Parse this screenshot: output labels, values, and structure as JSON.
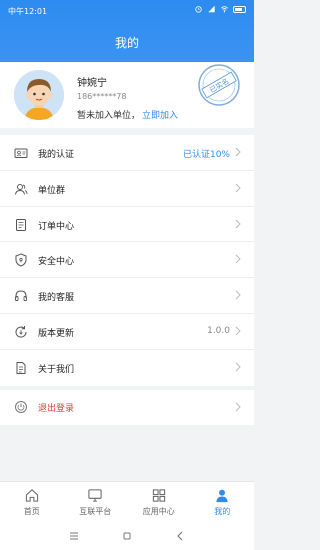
{
  "status": {
    "time": "中午12:01"
  },
  "header": {
    "title": "我的"
  },
  "profile": {
    "name": "钟婉宁",
    "phone": "186******78",
    "unit_text": "暂未加入单位，",
    "join_link": "立即加入",
    "stamp_text": "已实名"
  },
  "menu": [
    {
      "label": "我的认证",
      "value": "已认证10%",
      "icon": "id-card-icon"
    },
    {
      "label": "单位群",
      "value": "",
      "icon": "group-icon"
    },
    {
      "label": "订单中心",
      "value": "",
      "icon": "order-icon"
    },
    {
      "label": "安全中心",
      "value": "",
      "icon": "shield-icon"
    },
    {
      "label": "我的客服",
      "value": "",
      "icon": "headset-icon"
    },
    {
      "label": "版本更新",
      "value": "1.0.0",
      "icon": "update-icon"
    },
    {
      "label": "关于我们",
      "value": "",
      "icon": "document-icon"
    }
  ],
  "logout": {
    "label": "退出登录",
    "icon": "power-icon"
  },
  "tabs": [
    {
      "label": "首页",
      "icon": "home-icon",
      "active": false
    },
    {
      "label": "互联平台",
      "icon": "monitor-icon",
      "active": false
    },
    {
      "label": "应用中心",
      "icon": "grid-icon",
      "active": false
    },
    {
      "label": "我的",
      "icon": "user-icon",
      "active": true
    }
  ],
  "colors": {
    "accent": "#2d8cf0",
    "danger": "#e03a3a"
  }
}
